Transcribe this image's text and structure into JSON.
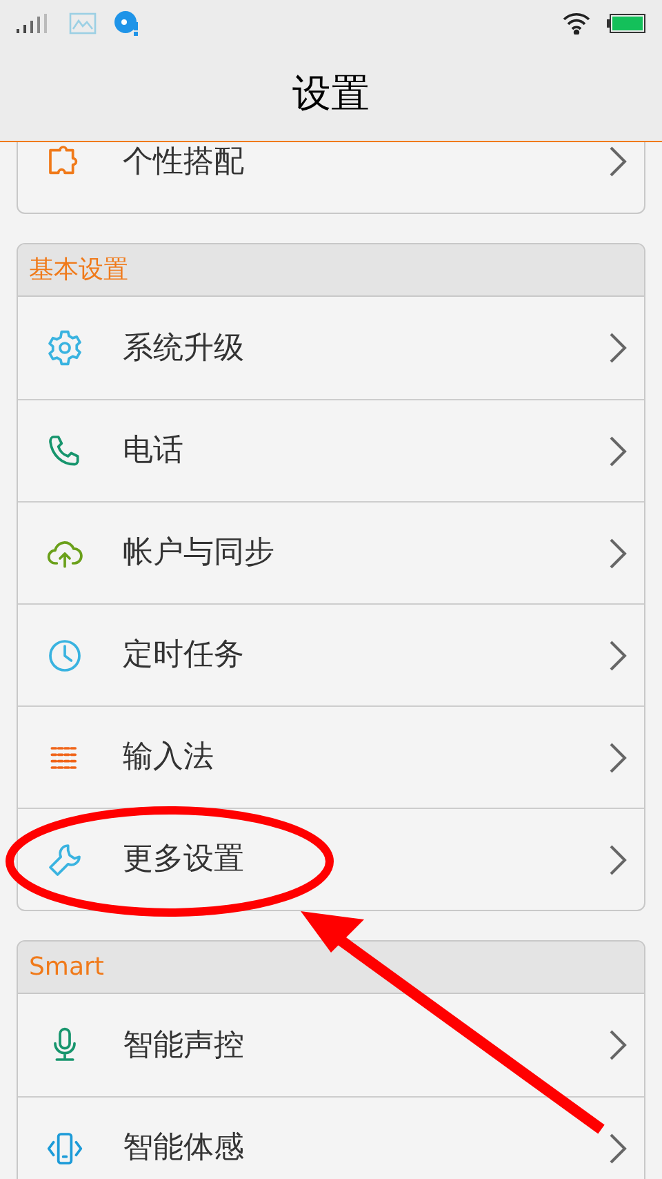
{
  "title": "设置",
  "sections": [
    {
      "items": [
        {
          "label": "个性搭配"
        }
      ]
    },
    {
      "header": "基本设置",
      "items": [
        {
          "label": "系统升级"
        },
        {
          "label": "电话"
        },
        {
          "label": "帐户与同步"
        },
        {
          "label": "定时任务"
        },
        {
          "label": "输入法"
        },
        {
          "label": "更多设置"
        }
      ]
    },
    {
      "header": "Smart",
      "items": [
        {
          "label": "智能声控"
        },
        {
          "label": "智能体感"
        }
      ]
    }
  ]
}
